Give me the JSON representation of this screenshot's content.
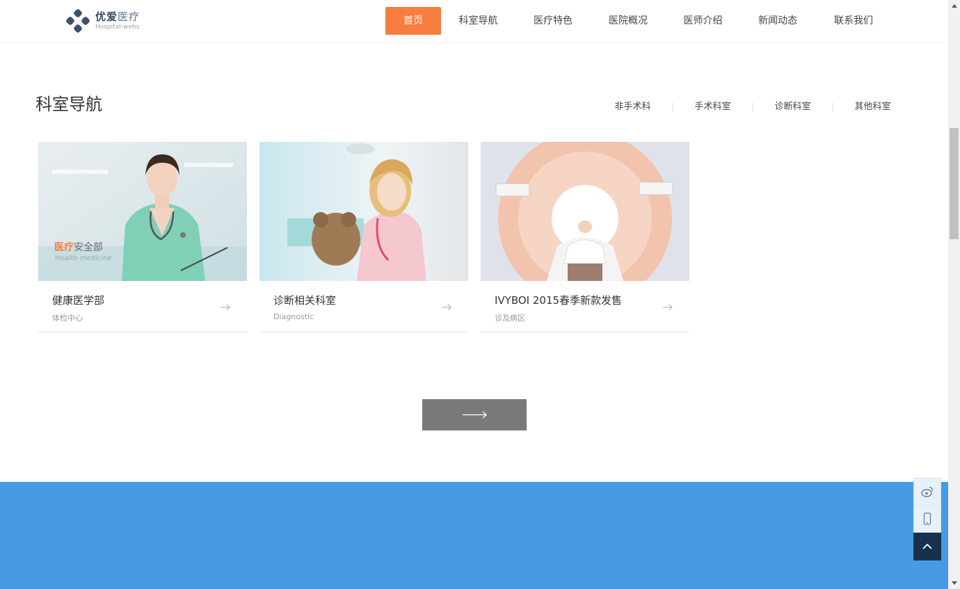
{
  "logo": {
    "title_a": "优爱",
    "title_b": "医疗",
    "subtitle": "Hospital-webs"
  },
  "nav": [
    {
      "label": "首页",
      "active": true,
      "width": 80
    },
    {
      "label": "科室导航",
      "active": false,
      "width": 107
    },
    {
      "label": "医疗特色",
      "active": false,
      "width": 108
    },
    {
      "label": "医院概况",
      "active": false,
      "width": 108
    },
    {
      "label": "医师介绍",
      "active": false,
      "width": 107
    },
    {
      "label": "新闻动态",
      "active": false,
      "width": 108
    },
    {
      "label": "联系我们",
      "active": false,
      "width": 110
    }
  ],
  "section": {
    "title": "科室导航",
    "tabs": [
      "非手术科",
      "手术科室",
      "诊断科室",
      "其他科室"
    ]
  },
  "cards": [
    {
      "title": "健康医学部",
      "subtitle": "体检中心",
      "overlay_title_a": "医疗",
      "overlay_title_b": "安全部",
      "overlay_sub": "Health medicine"
    },
    {
      "title": "诊断相关科室",
      "subtitle": "Diagnostic"
    },
    {
      "title": "IVYBOI 2015春季新款发售",
      "subtitle": "诊及病区"
    }
  ],
  "colors": {
    "accent": "#f97d3e",
    "band": "#479be3",
    "back_top": "#17304e",
    "more_button": "#7a7a7a"
  },
  "float_icons": [
    "weibo-icon",
    "mobile-icon",
    "chevron-up-icon"
  ]
}
